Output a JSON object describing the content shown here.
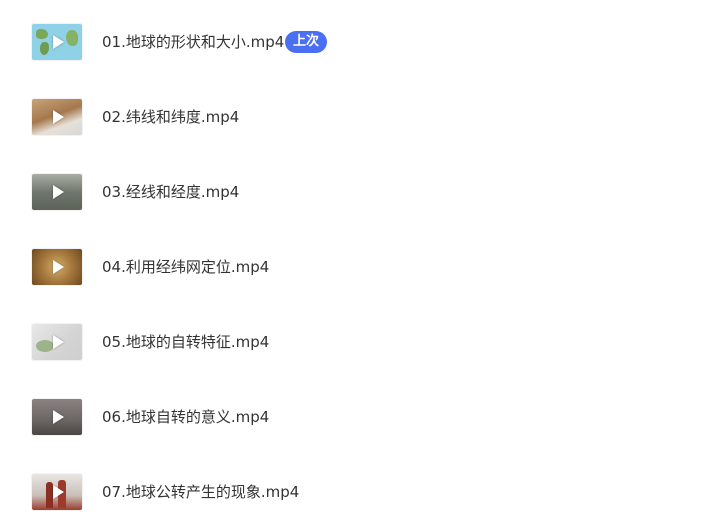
{
  "files": [
    {
      "name": "01.地球的形状和大小.mp4",
      "thumb_icon": "video-thumbnail-icon",
      "badge": "上次"
    },
    {
      "name": "02.纬线和纬度.mp4",
      "thumb_icon": "video-thumbnail-icon"
    },
    {
      "name": "03.经线和经度.mp4",
      "thumb_icon": "video-thumbnail-icon"
    },
    {
      "name": "04.利用经纬网定位.mp4",
      "thumb_icon": "video-thumbnail-icon"
    },
    {
      "name": "05.地球的自转特征.mp4",
      "thumb_icon": "video-thumbnail-icon"
    },
    {
      "name": "06.地球自转的意义.mp4",
      "thumb_icon": "video-thumbnail-icon"
    },
    {
      "name": "07.地球公转产生的现象.mp4",
      "thumb_icon": "video-thumbnail-icon"
    }
  ],
  "colors": {
    "badge_background": "#4a6ff3",
    "text": "#333333",
    "background": "#ffffff"
  }
}
